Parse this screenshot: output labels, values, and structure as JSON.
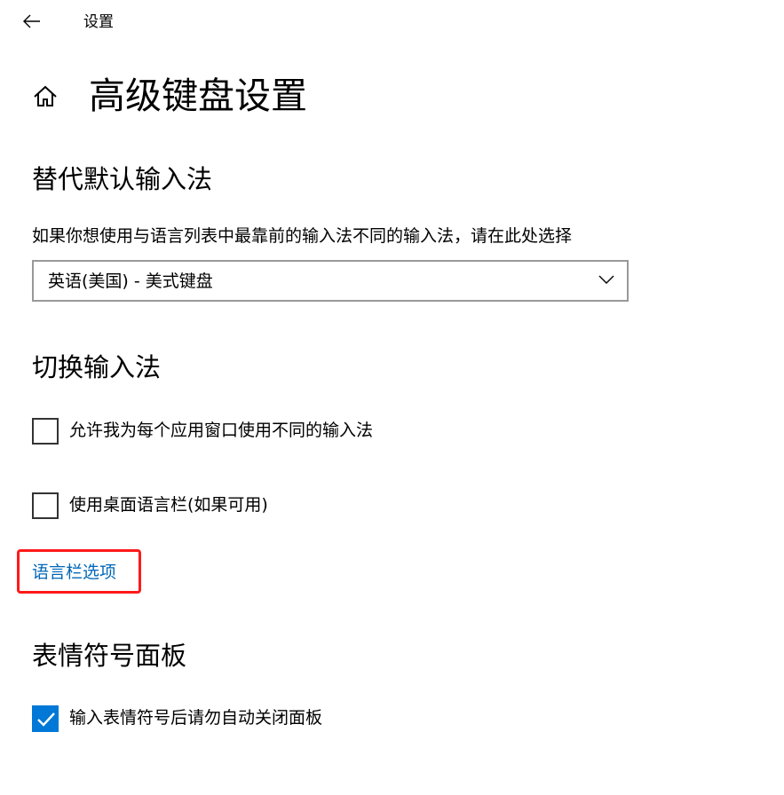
{
  "window": {
    "app_title": "设置",
    "back_icon": "back-arrow-icon"
  },
  "page": {
    "title": "高级键盘设置",
    "home_icon": "home-icon"
  },
  "override_section": {
    "heading": "替代默认输入法",
    "description": "如果你想使用与语言列表中最靠前的输入法不同的输入法，请在此处选择",
    "dropdown_value": "英语(美国) - 美式键盘"
  },
  "switch_section": {
    "heading": "切换输入法",
    "checkboxes": [
      {
        "label": "允许我为每个应用窗口使用不同的输入法",
        "checked": false
      },
      {
        "label": "使用桌面语言栏(如果可用)",
        "checked": false
      }
    ],
    "link_label": "语言栏选项",
    "highlight_color": "#ff1a1a"
  },
  "emoji_section": {
    "heading": "表情符号面板",
    "checkbox": {
      "label": "输入表情符号后请勿自动关闭面板",
      "checked": true
    }
  },
  "colors": {
    "accent": "#0078d7",
    "link": "#0067b8"
  }
}
